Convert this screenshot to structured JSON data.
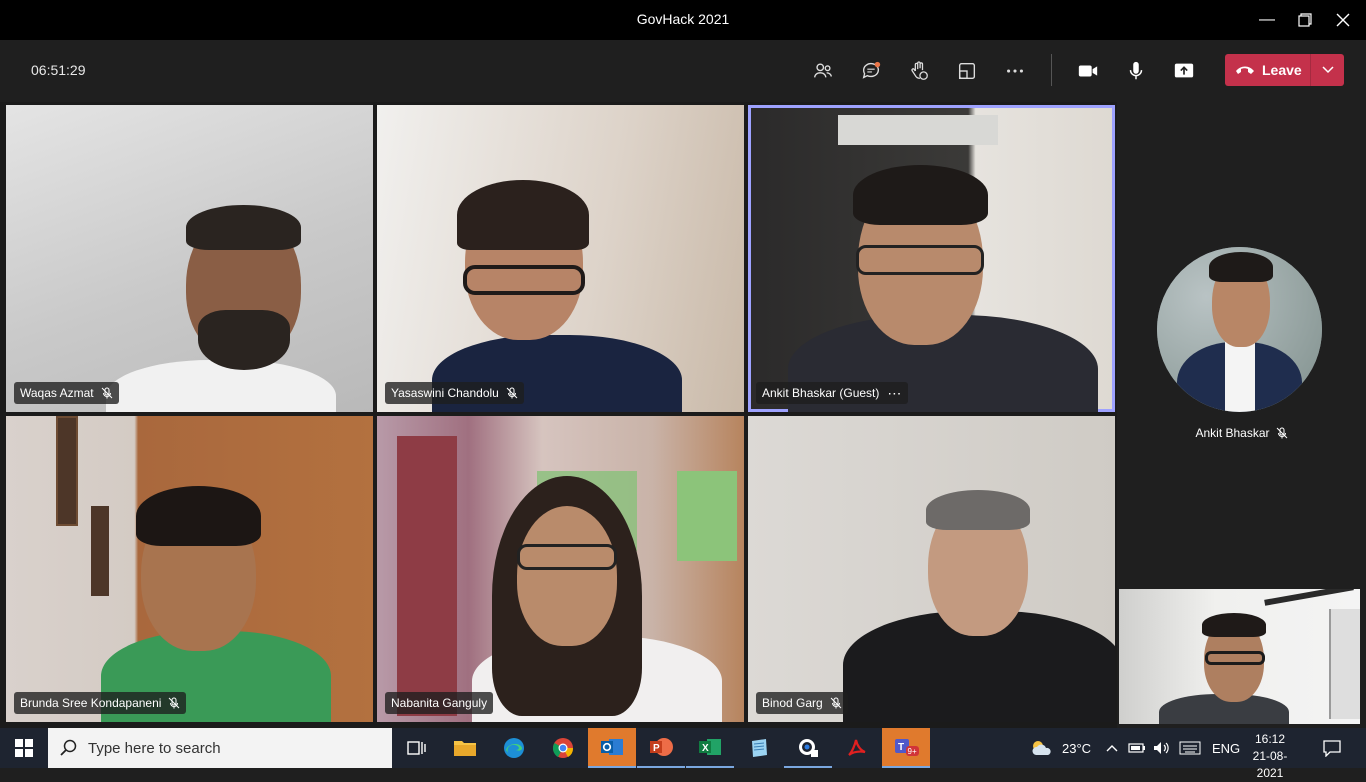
{
  "window": {
    "title": "GovHack 2021"
  },
  "toolbar": {
    "timer": "06:51:29",
    "leave_label": "Leave"
  },
  "participants": [
    {
      "name": "Waqas Azmat",
      "muted": true
    },
    {
      "name": "Yasaswini Chandolu",
      "muted": true
    },
    {
      "name": "Ankit Bhaskar (Guest)",
      "muted": false,
      "active": true
    },
    {
      "name": "Brunda Sree Kondapaneni",
      "muted": true
    },
    {
      "name": "Nabanita Ganguly",
      "muted": false
    },
    {
      "name": "Binod Garg",
      "muted": true
    }
  ],
  "side": {
    "name": "Ankit Bhaskar",
    "muted": true
  },
  "taskbar": {
    "search_placeholder": "Type here to search",
    "temperature": "23°C",
    "language": "ENG",
    "time": "16:12",
    "date": "21-08-2021",
    "teams_badge": "9+"
  },
  "colors": {
    "leave": "#c4314b",
    "active_border": "#9ea2ff",
    "taskbar": "#1e2430"
  }
}
